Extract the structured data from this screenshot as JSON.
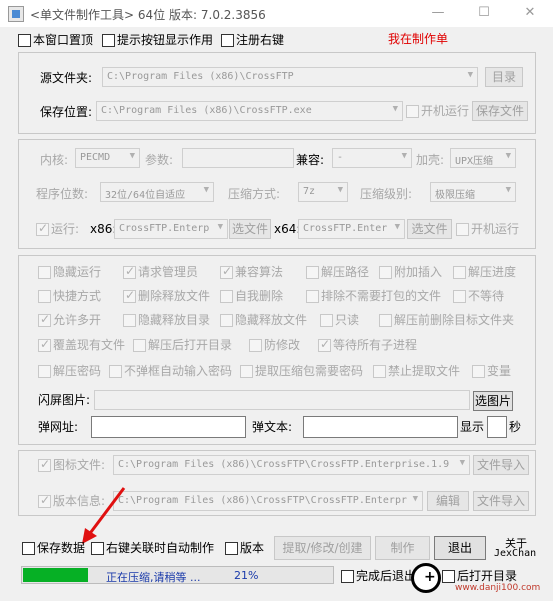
{
  "window": {
    "title": "<单文件制作工具> 64位 版本: 7.0.2.3856",
    "minimize": "—",
    "maximize": "☐",
    "close": "✕"
  },
  "top_options": {
    "stay_on_top": "本窗口置顶",
    "show_tooltips": "提示按钮显示作用",
    "register_context": "注册右键",
    "status_note": "我在制作单",
    "status_color": "#e00000"
  },
  "source": {
    "src_label": "源文件夹:",
    "src_value": "C:\\Program Files (x86)\\CrossFTP",
    "src_btn": "目录",
    "save_label": "保存位置:",
    "save_value": "C:\\Program Files (x86)\\CrossFTP.exe",
    "startup_run": "开机运行",
    "save_btn": "保存文件"
  },
  "kernel": {
    "kernel_label": "内核:",
    "kernel_value": "PECMD",
    "param_label": "参数:",
    "param_value": "",
    "compat_label": "兼容:",
    "compat_value": "-",
    "shell_label": "加壳:",
    "shell_value": "UPX压缩",
    "bits_label": "程序位数:",
    "bits_value": "32位/64位自适应",
    "method_label": "压缩方式:",
    "method_value": "7z",
    "level_label": "压缩级别:",
    "level_value": "极限压缩",
    "run_label": "运行:",
    "x86_label": "x86:",
    "x86_value": "CrossFTP.Enterp",
    "pick86": "选文件",
    "x64_label": "x64:",
    "x64_value": "CrossFTP.Enter",
    "pick64": "选文件",
    "startup": "开机运行"
  },
  "options": {
    "row1": [
      "隐藏运行",
      "请求管理员",
      "兼容算法",
      "解压路径",
      "附加插入",
      "解压进度"
    ],
    "row2": [
      "快捷方式",
      "删除释放文件",
      "自我删除",
      "排除不需要打包的文件",
      "不等待"
    ],
    "row3": [
      "允许多开",
      "隐藏释放目录",
      "隐藏释放文件",
      "只读",
      "解压前删除目标文件夹"
    ],
    "row4": [
      "覆盖现有文件",
      "解压后打开目录",
      "防修改",
      "等待所有子进程"
    ],
    "row5": [
      "解压密码",
      "不弹框自动输入密码",
      "提取压缩包需要密码",
      "禁止提取文件",
      "变量"
    ],
    "splash_label": "闪屏图片:",
    "splash_btn": "选图片",
    "popup_url_label": "弹网址:",
    "popup_text_label": "弹文本:",
    "show_label": "显示",
    "seconds_label": "秒"
  },
  "icon_version": {
    "icon_label": "图标文件:",
    "icon_value": "C:\\Program Files (x86)\\CrossFTP\\CrossFTP.Enterprise.1.9",
    "icon_btn": "文件导入",
    "ver_label": "版本信息:",
    "ver_value": "C:\\Program Files (x86)\\CrossFTP\\CrossFTP.Enterpr",
    "edit_btn": "编辑",
    "ver_btn": "文件导入"
  },
  "bottom": {
    "save_data": "保存数据",
    "auto_make": "右键关联时自动制作",
    "version": "版本",
    "extract_btn": "提取/修改/创建",
    "make_btn": "制作",
    "exit_btn": "退出",
    "about": "关于",
    "author": "JexChan"
  },
  "status": {
    "progress_text": "正在压缩,请稍等 ...",
    "percent_text": "21%",
    "percent": 21,
    "after_done": "完成后退出",
    "after_open": "后打开目录",
    "watermark": "www.danji100.com"
  }
}
